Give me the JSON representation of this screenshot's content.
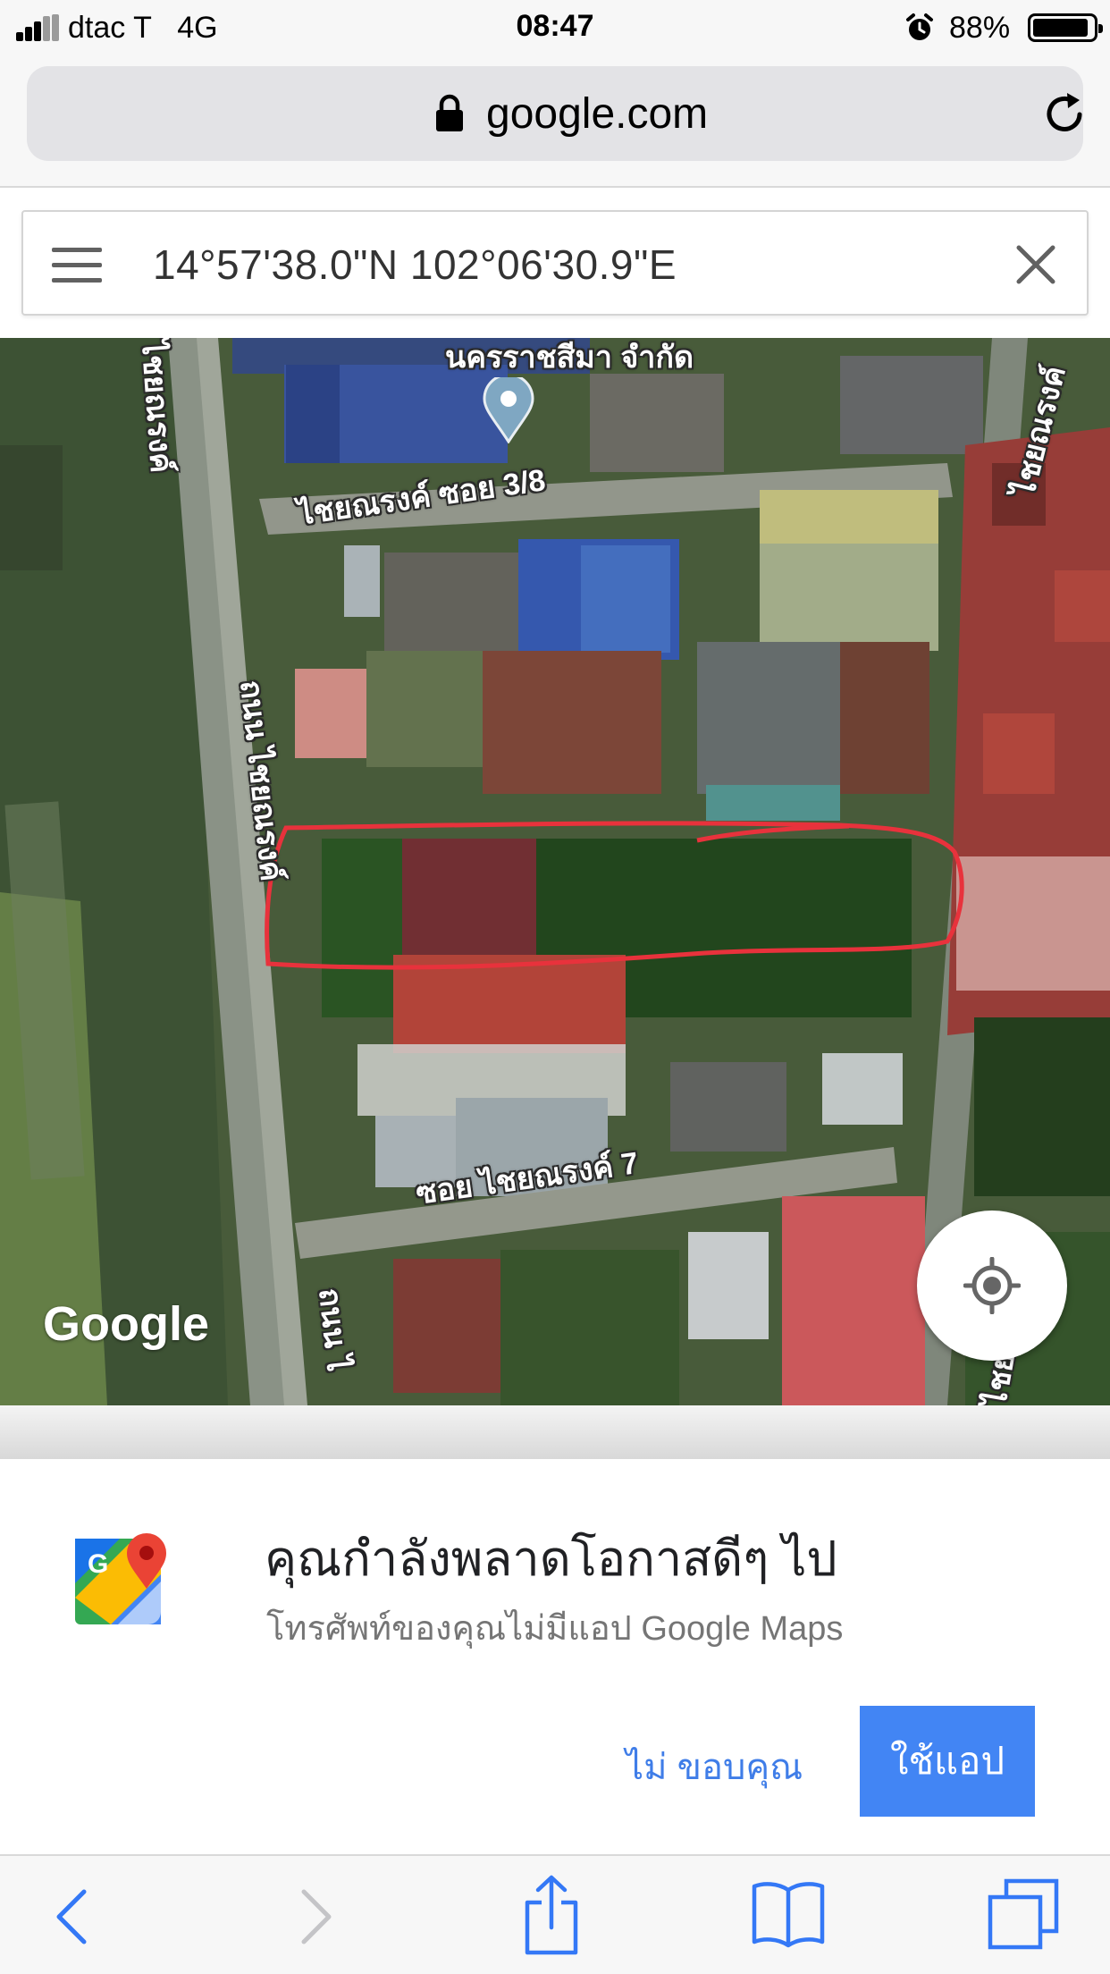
{
  "status_bar": {
    "carrier": "dtac T",
    "network": "4G",
    "time": "08:47",
    "battery_percent": "88%",
    "battery_level": 0.88,
    "icons": [
      "signal-icon",
      "alarm-icon",
      "battery-icon"
    ]
  },
  "browser": {
    "url": "google.com",
    "icons": [
      "lock-icon",
      "reload-icon"
    ]
  },
  "maps": {
    "search_value": "14°57'38.0\"N 102°06'30.9\"E",
    "icons": [
      "menu-icon",
      "close-icon",
      "location-pin-icon",
      "my-location-icon"
    ],
    "labels": {
      "top_business": "นครราชสีมา จำกัด",
      "soi_3_8": "ไชยณรงค์ ซอย 3/8",
      "soi_7": "ซอย ไชยณรงค์ 7",
      "road_main": "ถนน ไชยณรงค์",
      "road_top_left": "ไชยณรงค์",
      "road_top_right": "ไชยณรงค์",
      "road_bottom": "ถนน ไ",
      "road_bottom_right": "ไชย"
    },
    "logo": "Google",
    "colors": {
      "annotation": "#e8323c",
      "pin": "#7fa7c2"
    }
  },
  "promo": {
    "title": "คุณกำลังพลาดโอกาสดีๆ ไป",
    "subtitle": "โทรศัพท์ของคุณไม่มีแอป Google Maps",
    "no_thanks": "ไม่ ขอบคุณ",
    "use_app": "ใช้แอป",
    "colors": {
      "button": "#4285f4",
      "link": "#3f7de8"
    }
  },
  "toolbar": {
    "icons": [
      "back-icon",
      "forward-icon",
      "share-icon",
      "bookmarks-icon",
      "tabs-icon"
    ]
  }
}
